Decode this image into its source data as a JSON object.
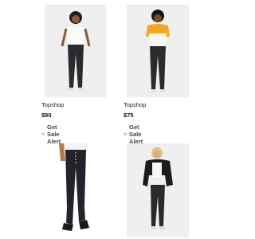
{
  "products": [
    {
      "brand": "Topshop",
      "price": "$80",
      "alert_label": "Get Sale Alert",
      "top_color": "#f7f7f7"
    },
    {
      "brand": "Topshop",
      "price": "$75",
      "alert_label": "Get Sale Alert",
      "top_color": "#f5a623"
    },
    {
      "brand": "",
      "price": "",
      "alert_label": "",
      "top_color": "#ffffff"
    },
    {
      "brand": "",
      "price": "",
      "alert_label": "",
      "top_color": "#1c1c1c"
    }
  ],
  "colors": {
    "tile_bg": "#ededed",
    "jeans": "#2b2b2f",
    "accent_heart": "#444444"
  }
}
